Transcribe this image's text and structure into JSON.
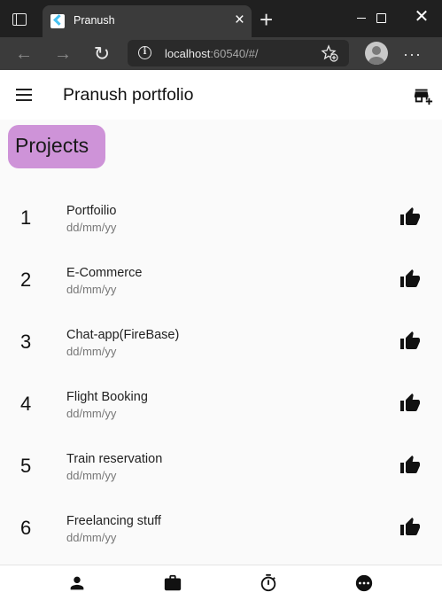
{
  "browser": {
    "tab_title": "Pranush",
    "tab_close": "×",
    "new_tab": "+",
    "window_close": "✕",
    "url_host": "localhost",
    "url_rest": ":60540/#/",
    "back": "←",
    "forward": "→",
    "reload": "↻",
    "more": "···"
  },
  "app": {
    "title": "Pranush portfolio",
    "section_label": "Projects",
    "projects": [
      {
        "number": "1",
        "title": "Portfoilio",
        "date": "dd/mm/yy"
      },
      {
        "number": "2",
        "title": "E-Commerce",
        "date": "dd/mm/yy"
      },
      {
        "number": "3",
        "title": "Chat-app(FireBase)",
        "date": "dd/mm/yy"
      },
      {
        "number": "4",
        "title": "Flight Booking",
        "date": "dd/mm/yy"
      },
      {
        "number": "5",
        "title": "Train reservation",
        "date": "dd/mm/yy"
      },
      {
        "number": "6",
        "title": "Freelancing stuff",
        "date": "dd/mm/yy"
      }
    ],
    "bottom_nav_icons": [
      "person-icon",
      "work-icon",
      "timer-icon",
      "more-horiz-icon"
    ]
  },
  "colors": {
    "chip": "#ce93d8",
    "app_background": "#fafafa",
    "browser_chrome": "#202020",
    "toolbar": "#3b3b3b"
  }
}
